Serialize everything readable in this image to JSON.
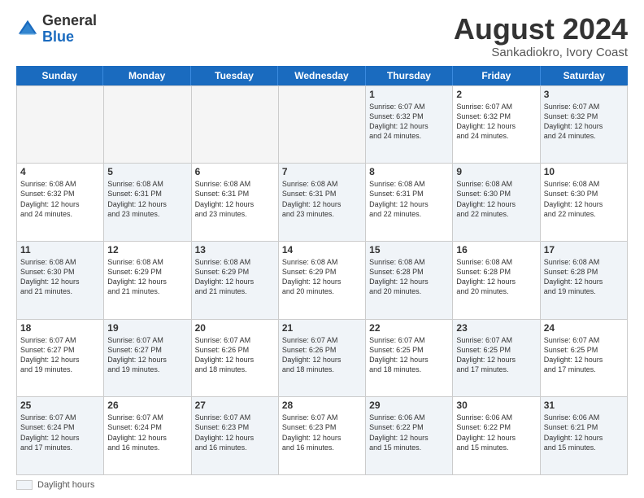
{
  "logo": {
    "general": "General",
    "blue": "Blue"
  },
  "title": {
    "month_year": "August 2024",
    "location": "Sankadiokro, Ivory Coast"
  },
  "weekdays": [
    "Sunday",
    "Monday",
    "Tuesday",
    "Wednesday",
    "Thursday",
    "Friday",
    "Saturday"
  ],
  "footer": {
    "swatch_label": "Daylight hours"
  },
  "weeks": [
    [
      {
        "day": "",
        "info": "",
        "empty": true
      },
      {
        "day": "",
        "info": "",
        "empty": true
      },
      {
        "day": "",
        "info": "",
        "empty": true
      },
      {
        "day": "",
        "info": "",
        "empty": true
      },
      {
        "day": "1",
        "info": "Sunrise: 6:07 AM\nSunset: 6:32 PM\nDaylight: 12 hours\nand 24 minutes.",
        "shaded": true
      },
      {
        "day": "2",
        "info": "Sunrise: 6:07 AM\nSunset: 6:32 PM\nDaylight: 12 hours\nand 24 minutes.",
        "shaded": false
      },
      {
        "day": "3",
        "info": "Sunrise: 6:07 AM\nSunset: 6:32 PM\nDaylight: 12 hours\nand 24 minutes.",
        "shaded": true
      }
    ],
    [
      {
        "day": "4",
        "info": "Sunrise: 6:08 AM\nSunset: 6:32 PM\nDaylight: 12 hours\nand 24 minutes.",
        "shaded": false
      },
      {
        "day": "5",
        "info": "Sunrise: 6:08 AM\nSunset: 6:31 PM\nDaylight: 12 hours\nand 23 minutes.",
        "shaded": true
      },
      {
        "day": "6",
        "info": "Sunrise: 6:08 AM\nSunset: 6:31 PM\nDaylight: 12 hours\nand 23 minutes.",
        "shaded": false
      },
      {
        "day": "7",
        "info": "Sunrise: 6:08 AM\nSunset: 6:31 PM\nDaylight: 12 hours\nand 23 minutes.",
        "shaded": true
      },
      {
        "day": "8",
        "info": "Sunrise: 6:08 AM\nSunset: 6:31 PM\nDaylight: 12 hours\nand 22 minutes.",
        "shaded": false
      },
      {
        "day": "9",
        "info": "Sunrise: 6:08 AM\nSunset: 6:30 PM\nDaylight: 12 hours\nand 22 minutes.",
        "shaded": true
      },
      {
        "day": "10",
        "info": "Sunrise: 6:08 AM\nSunset: 6:30 PM\nDaylight: 12 hours\nand 22 minutes.",
        "shaded": false
      }
    ],
    [
      {
        "day": "11",
        "info": "Sunrise: 6:08 AM\nSunset: 6:30 PM\nDaylight: 12 hours\nand 21 minutes.",
        "shaded": true
      },
      {
        "day": "12",
        "info": "Sunrise: 6:08 AM\nSunset: 6:29 PM\nDaylight: 12 hours\nand 21 minutes.",
        "shaded": false
      },
      {
        "day": "13",
        "info": "Sunrise: 6:08 AM\nSunset: 6:29 PM\nDaylight: 12 hours\nand 21 minutes.",
        "shaded": true
      },
      {
        "day": "14",
        "info": "Sunrise: 6:08 AM\nSunset: 6:29 PM\nDaylight: 12 hours\nand 20 minutes.",
        "shaded": false
      },
      {
        "day": "15",
        "info": "Sunrise: 6:08 AM\nSunset: 6:28 PM\nDaylight: 12 hours\nand 20 minutes.",
        "shaded": true
      },
      {
        "day": "16",
        "info": "Sunrise: 6:08 AM\nSunset: 6:28 PM\nDaylight: 12 hours\nand 20 minutes.",
        "shaded": false
      },
      {
        "day": "17",
        "info": "Sunrise: 6:08 AM\nSunset: 6:28 PM\nDaylight: 12 hours\nand 19 minutes.",
        "shaded": true
      }
    ],
    [
      {
        "day": "18",
        "info": "Sunrise: 6:07 AM\nSunset: 6:27 PM\nDaylight: 12 hours\nand 19 minutes.",
        "shaded": false
      },
      {
        "day": "19",
        "info": "Sunrise: 6:07 AM\nSunset: 6:27 PM\nDaylight: 12 hours\nand 19 minutes.",
        "shaded": true
      },
      {
        "day": "20",
        "info": "Sunrise: 6:07 AM\nSunset: 6:26 PM\nDaylight: 12 hours\nand 18 minutes.",
        "shaded": false
      },
      {
        "day": "21",
        "info": "Sunrise: 6:07 AM\nSunset: 6:26 PM\nDaylight: 12 hours\nand 18 minutes.",
        "shaded": true
      },
      {
        "day": "22",
        "info": "Sunrise: 6:07 AM\nSunset: 6:25 PM\nDaylight: 12 hours\nand 18 minutes.",
        "shaded": false
      },
      {
        "day": "23",
        "info": "Sunrise: 6:07 AM\nSunset: 6:25 PM\nDaylight: 12 hours\nand 17 minutes.",
        "shaded": true
      },
      {
        "day": "24",
        "info": "Sunrise: 6:07 AM\nSunset: 6:25 PM\nDaylight: 12 hours\nand 17 minutes.",
        "shaded": false
      }
    ],
    [
      {
        "day": "25",
        "info": "Sunrise: 6:07 AM\nSunset: 6:24 PM\nDaylight: 12 hours\nand 17 minutes.",
        "shaded": true
      },
      {
        "day": "26",
        "info": "Sunrise: 6:07 AM\nSunset: 6:24 PM\nDaylight: 12 hours\nand 16 minutes.",
        "shaded": false
      },
      {
        "day": "27",
        "info": "Sunrise: 6:07 AM\nSunset: 6:23 PM\nDaylight: 12 hours\nand 16 minutes.",
        "shaded": true
      },
      {
        "day": "28",
        "info": "Sunrise: 6:07 AM\nSunset: 6:23 PM\nDaylight: 12 hours\nand 16 minutes.",
        "shaded": false
      },
      {
        "day": "29",
        "info": "Sunrise: 6:06 AM\nSunset: 6:22 PM\nDaylight: 12 hours\nand 15 minutes.",
        "shaded": true
      },
      {
        "day": "30",
        "info": "Sunrise: 6:06 AM\nSunset: 6:22 PM\nDaylight: 12 hours\nand 15 minutes.",
        "shaded": false
      },
      {
        "day": "31",
        "info": "Sunrise: 6:06 AM\nSunset: 6:21 PM\nDaylight: 12 hours\nand 15 minutes.",
        "shaded": true
      }
    ]
  ]
}
